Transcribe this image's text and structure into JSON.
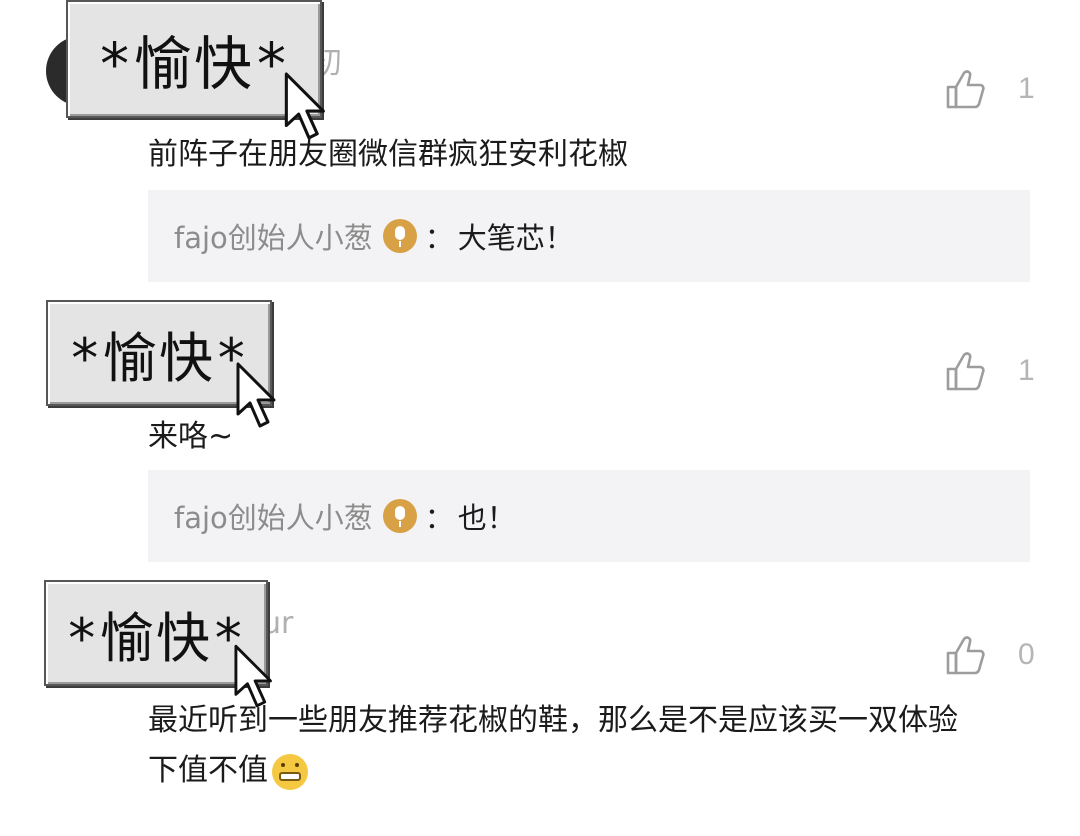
{
  "comments": [
    {
      "username_fragment": "初",
      "likes": "1",
      "text": "前阵子在朋友圈微信群疯狂安利花椒",
      "reply": {
        "author": "fajo创始人小葱",
        "separator": "：",
        "text": "大笔芯！"
      },
      "sticker": "*愉快*"
    },
    {
      "username_fragment": "",
      "likes": "1",
      "text": "来咯~",
      "reply": {
        "author": "fajo创始人小葱",
        "separator": "：",
        "text": "也！"
      },
      "sticker": "*愉快*"
    },
    {
      "username_fragment": "ur",
      "likes": "0",
      "text_line1": "最近听到一些朋友推荐花椒的鞋，那么是不是应该买一双体验",
      "text_line2": "下值不值",
      "sticker": "*愉快*"
    }
  ],
  "icons": {
    "like": "thumbs-up-icon",
    "badge": "microphone-badge-icon",
    "emoji": "grinning-emoji-icon",
    "cursor": "mouse-cursor-icon"
  },
  "colors": {
    "reply_bg": "#f3f3f5",
    "badge": "#d9a146",
    "like_gray": "#b5b5b5"
  }
}
